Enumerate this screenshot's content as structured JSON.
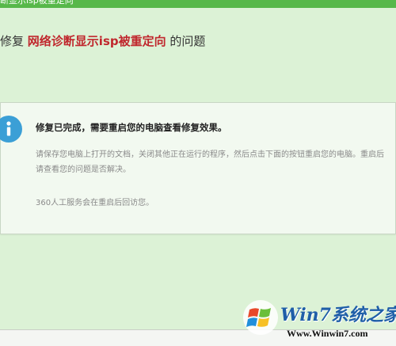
{
  "window": {
    "top_text": "断显示isp被重定向"
  },
  "heading": {
    "prefix": "修复",
    "highlight": "网络诊断显示isp被重定向",
    "suffix": "的问题"
  },
  "result_panel": {
    "icon": "info-icon",
    "title": "修复已完成，需要重启您的电脑查看修复效果。",
    "description": "请保存您电脑上打开的文档，关闭其他正在运行的程序，然后点击下面的按钮重启您的电脑。重启后请查看您的问题是否解决。",
    "note": "360人工服务会在重启后回访您。"
  },
  "watermark": {
    "brand": "Win7系统之家",
    "url": "Www.Winwin7.com"
  },
  "colors": {
    "top_bar": "#57b84a",
    "page_background": "#dcf2d6",
    "panel_background": "#f2f9f0",
    "highlight": "#c0272d",
    "info_icon": "#3b9fd6"
  }
}
